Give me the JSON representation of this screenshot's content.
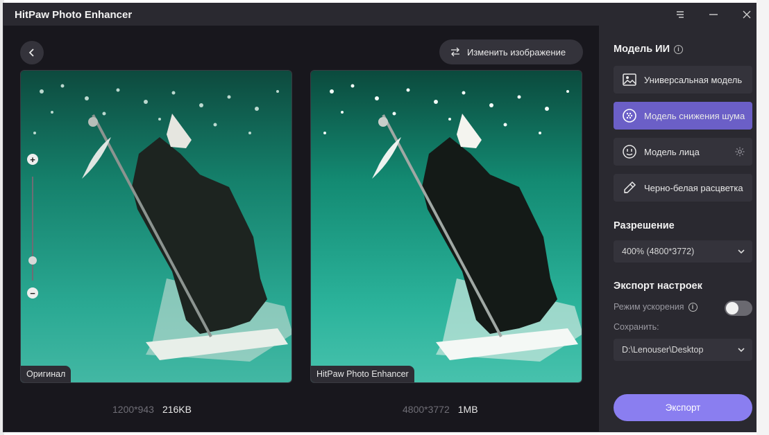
{
  "app": {
    "title": "HitPaw Photo Enhancer"
  },
  "toolbar": {
    "replace_label": "Изменить изображение"
  },
  "preview": {
    "original_label": "Оригинал",
    "enhanced_label": "HitPaw Photo Enhancer",
    "original_dims": "1200*943",
    "original_size": "216KB",
    "enhanced_dims": "4800*3772",
    "enhanced_size": "1MB",
    "zoom_level": 0.22
  },
  "sidebar": {
    "ai_model_title": "Модель ИИ",
    "models": [
      {
        "label": "Универсальная модель",
        "icon": "image-icon",
        "active": false
      },
      {
        "label": "Модель снижения шума",
        "icon": "denoise-icon",
        "active": true
      },
      {
        "label": "Модель лица",
        "icon": "face-icon",
        "active": false
      },
      {
        "label": "Черно-белая расцветка",
        "icon": "colorize-icon",
        "active": false
      }
    ],
    "resolution_title": "Разрешение",
    "resolution_value": "400% (4800*3772)",
    "export_settings_title": "Экспорт настроек",
    "accel_label": "Режим ускорения",
    "accel_enabled": false,
    "save_label": "Сохранить:",
    "save_path": "D:\\Lenouser\\Desktop",
    "export_label": "Экспорт"
  },
  "colors": {
    "accent": "#8a7ef0",
    "active_model": "#6b5fc7",
    "panel_bg": "#2a2930",
    "main_bg": "#18171d"
  }
}
